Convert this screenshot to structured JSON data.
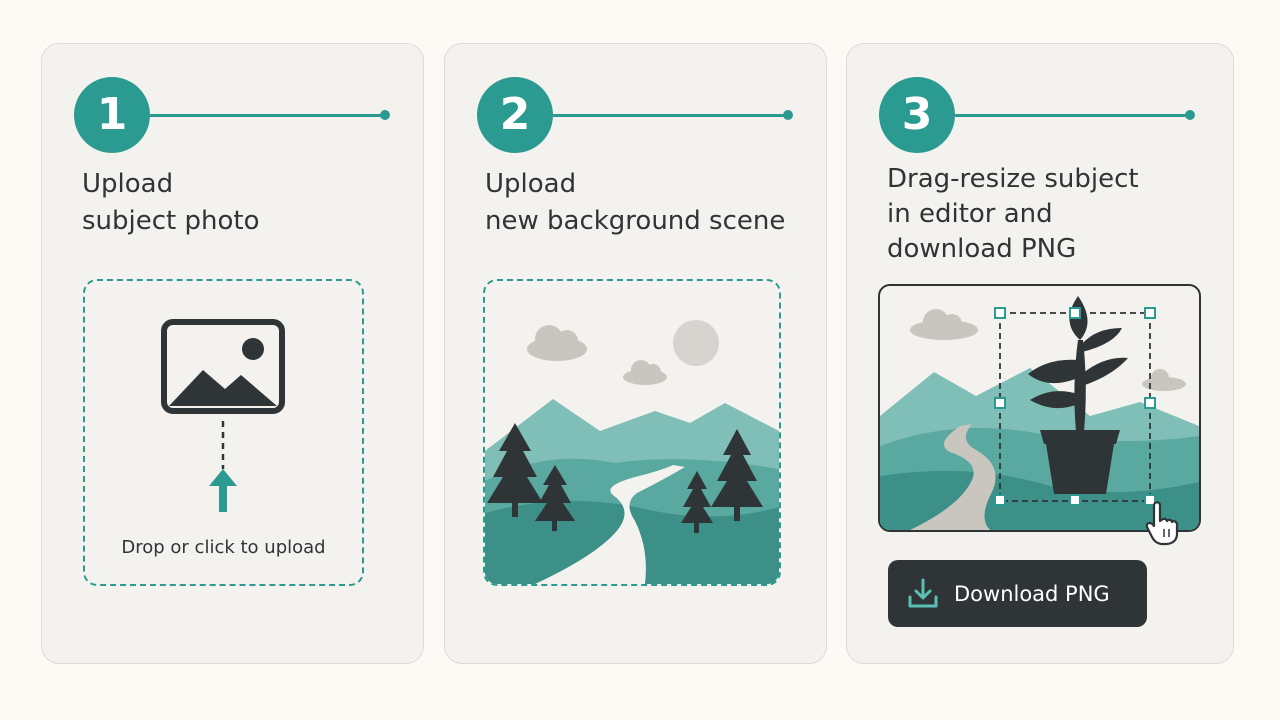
{
  "steps": [
    {
      "number": "1",
      "title_lines": [
        "Upload",
        "subject photo"
      ],
      "dropzone": {
        "icon": "image-icon",
        "upload_icon": "arrow-up-icon",
        "label": "Drop or click to upload"
      }
    },
    {
      "number": "2",
      "title_lines": [
        "Upload",
        "new background scene"
      ],
      "scene": {
        "icons": [
          "cloud-icon",
          "sun-icon",
          "pine-tree-icon",
          "mountain-icon",
          "river-icon"
        ]
      }
    },
    {
      "number": "3",
      "title_lines": [
        "Drag-resize subject",
        "in editor and",
        "download PNG"
      ],
      "editor": {
        "subject_icon": "potted-plant-icon",
        "cursor_icon": "hand-pointer-icon"
      },
      "download_button": {
        "label": "Download PNG",
        "icon": "download-icon"
      }
    }
  ],
  "colors": {
    "accent": "#2b9a90",
    "dark": "#2f3537",
    "card_bg": "#f3f2ee",
    "page_bg": "#fbfaf5",
    "mountain": "#7fbfb8",
    "hill": "#3d9088",
    "path": "#f3f2ee",
    "cloud": "#c9c6c0"
  }
}
